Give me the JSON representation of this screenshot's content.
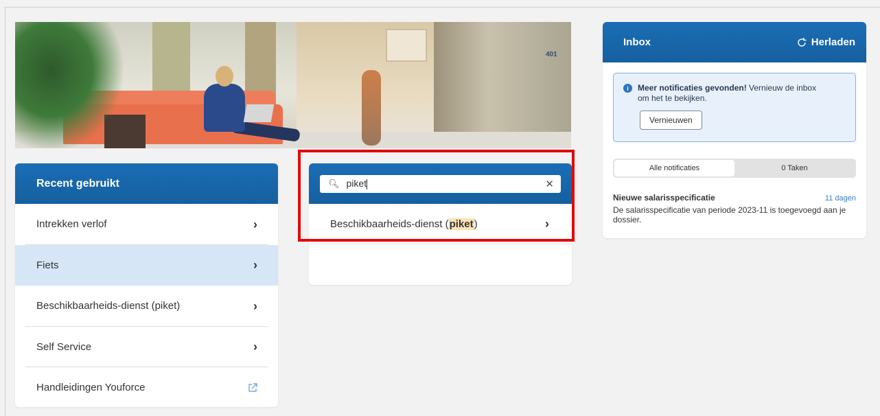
{
  "recent": {
    "title": "Recent gebruikt",
    "items": [
      {
        "label": "Intrekken verlof",
        "icon": "chevron-right-icon"
      },
      {
        "label": "Fiets",
        "icon": "chevron-right-icon"
      },
      {
        "label": "Beschikbaarheids-dienst (piket)",
        "icon": "chevron-right-icon"
      },
      {
        "label": "Self Service",
        "icon": "chevron-right-icon"
      },
      {
        "label": "Handleidingen Youforce",
        "icon": "external-link-icon"
      }
    ]
  },
  "search": {
    "value": "piket",
    "result_prefix": "Beschikbaarheids-dienst (",
    "result_match": "piket",
    "result_suffix": ")"
  },
  "inbox": {
    "title": "Inbox",
    "reload_label": "Herladen",
    "notice_bold": "Meer notificaties gevonden!",
    "notice_text": " Vernieuw de inbox om het te bekijken.",
    "notice_button": "Vernieuwen",
    "tabs": [
      "Alle notificaties",
      "0 Taken"
    ],
    "notification": {
      "title": "Nieuwe salarisspecificatie",
      "age": "11 dagen",
      "body": "De salarisspecificatie van periode 2023-11 is toegevoegd aan je dossier."
    }
  },
  "hero": {
    "room_number": "401"
  },
  "colors": {
    "header_blue": "#1b6db5",
    "active_row": "#d6e6f6",
    "highlight": "#fbe3b4",
    "annotation_red": "#e20a0a"
  }
}
